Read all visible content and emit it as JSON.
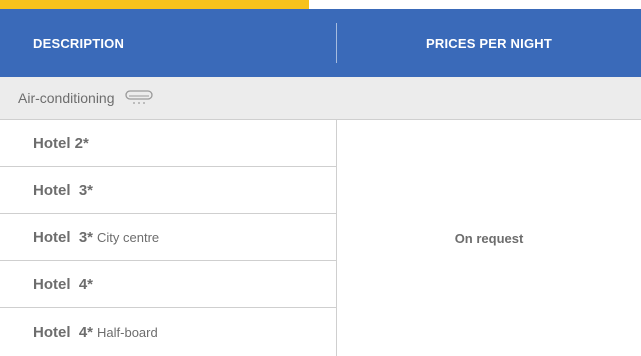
{
  "colors": {
    "accent": "#f7c21b",
    "header_bg": "#3a6ab9",
    "section_bg": "#ececec",
    "text": "#6d6d6d"
  },
  "table": {
    "headers": {
      "description": "DESCRIPTION",
      "price": "PRICES PER NIGHT"
    },
    "section": {
      "label": "Air-conditioning",
      "icon": "air-conditioner-icon"
    },
    "rows": [
      {
        "name": "Hotel 2*",
        "note": ""
      },
      {
        "name": "Hotel  3*",
        "note": ""
      },
      {
        "name": "Hotel  3*",
        "note": "City centre"
      },
      {
        "name": "Hotel  4*",
        "note": ""
      },
      {
        "name": "Hotel  4*",
        "note": "Half-board"
      }
    ],
    "price_value": "On request"
  }
}
